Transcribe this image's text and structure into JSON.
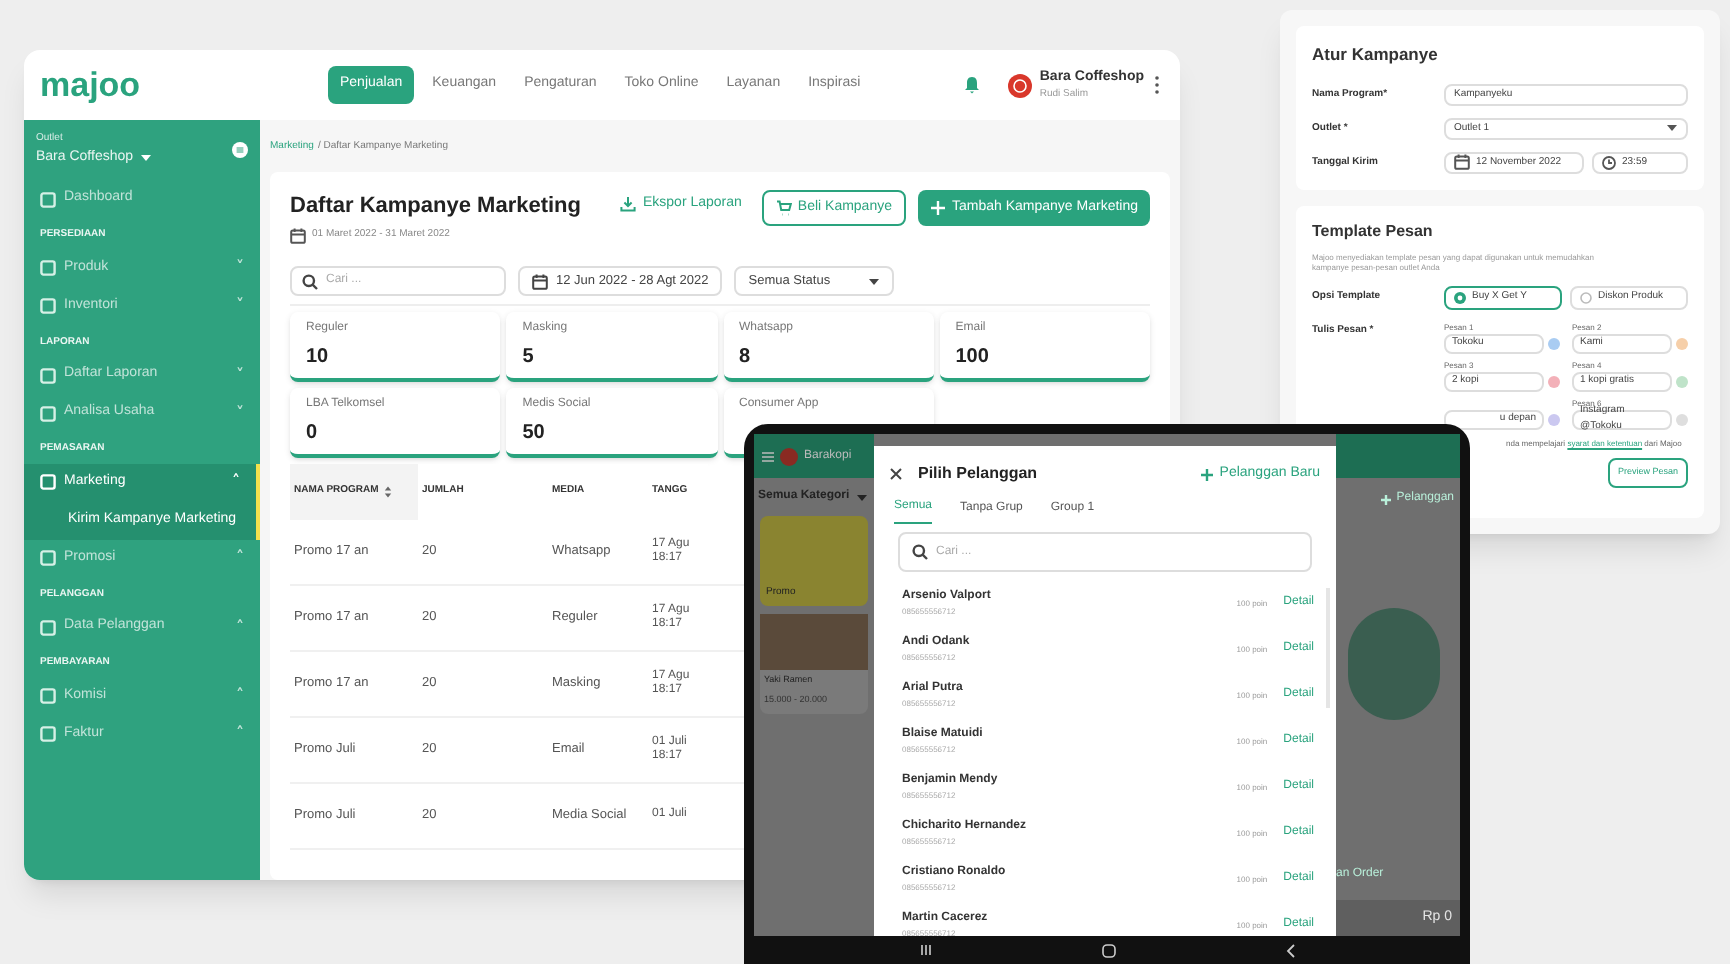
{
  "dashboard": {
    "logo": "majoo",
    "nav": [
      {
        "label": "Penjualan",
        "selected": true
      },
      {
        "label": "Keuangan",
        "selected": false
      },
      {
        "label": "Pengaturan",
        "selected": false
      },
      {
        "label": "Toko Online",
        "selected": false
      },
      {
        "label": "Layanan",
        "selected": false
      },
      {
        "label": "Inspirasi",
        "selected": false
      }
    ],
    "account": {
      "name": "Bara Coffeshop",
      "user": "Rudi Salim"
    },
    "sidebar": {
      "outlet_label": "Outlet",
      "outlet": "Bara Coffeshop",
      "sections": [
        {
          "items": [
            {
              "label": "Dashboard",
              "selected": false
            }
          ]
        },
        {
          "title": "PERSEDIAAN",
          "items": [
            {
              "label": "Produk",
              "toggle": "˅",
              "selected": false
            },
            {
              "label": "Inventori",
              "toggle": "˅",
              "selected": false
            }
          ]
        },
        {
          "title": "LAPORAN",
          "items": [
            {
              "label": "Daftar Laporan",
              "toggle": "˅",
              "selected": false
            },
            {
              "label": "Analisa Usaha",
              "toggle": "˅",
              "selected": false
            }
          ]
        },
        {
          "title": "PEMASARAN",
          "items": [
            {
              "label": "Marketing",
              "toggle": "˄",
              "selected": true,
              "children": [
                {
                  "label": "Kirim Kampanye Marketing",
                  "selected": true
                }
              ]
            },
            {
              "label": "Promosi",
              "toggle": "˄",
              "selected": false
            }
          ]
        },
        {
          "title": "PELANGGAN",
          "items": [
            {
              "label": "Data Pelanggan",
              "toggle": "˄",
              "selected": false
            }
          ]
        },
        {
          "title": "PEMBAYARAN",
          "items": [
            {
              "label": "Komisi",
              "toggle": "˄",
              "selected": false
            },
            {
              "label": "Faktur",
              "toggle": "˄",
              "selected": false
            }
          ]
        }
      ]
    },
    "breadcrumb": {
      "link": "Marketing",
      "current": "/ Daftar Kampanye Marketing"
    },
    "page": {
      "title": "Daftar Kampanye Marketing",
      "period": "01 Maret 2022 - 31 Maret 2022",
      "export": "Ekspor Laporan",
      "buy": "Beli Kampanye",
      "add": "Tambah Kampanye Marketing"
    },
    "filters": {
      "search_placeholder": "Cari ...",
      "date_range": "12 Jun 2022 - 28 Agt 2022",
      "status": "Semua Status"
    },
    "stats": [
      {
        "label": "Reguler",
        "value": "10"
      },
      {
        "label": "Masking",
        "value": "5"
      },
      {
        "label": "Whatsapp",
        "value": "8"
      },
      {
        "label": "Email",
        "value": "100"
      },
      {
        "label": "LBA Telkomsel",
        "value": "0"
      },
      {
        "label": "Medis Social",
        "value": "50"
      },
      {
        "label": "Consumer App"
      }
    ],
    "table": {
      "columns": [
        {
          "label": "NAMA PROGRAM",
          "sortable": true
        },
        {
          "label": "JUMLAH",
          "sortable": false
        },
        {
          "label": "MEDIA",
          "sortable": false
        },
        {
          "label": "TANGG",
          "sortable": false
        }
      ],
      "rows": [
        [
          "Promo 17 an",
          "20",
          "Whatsapp",
          "17 Agu",
          "18:17"
        ],
        [
          "Promo 17 an",
          "20",
          "Reguler",
          "17 Agu",
          "18:17"
        ],
        [
          "Promo 17 an",
          "20",
          "Masking",
          "17 Agu",
          "18:17"
        ],
        [
          "Promo Juli",
          "20",
          "Email",
          "01 Juli",
          "18:17"
        ],
        [
          "Promo Juli",
          "20",
          "Media Social",
          "01 Juli"
        ]
      ]
    }
  },
  "campaign_form": {
    "title": "Atur Kampanye",
    "fields": [
      {
        "label": "Nama Program*",
        "kind": "text",
        "value": "Kampanyeku"
      },
      {
        "label": "Outlet *",
        "kind": "select",
        "value": "Outlet 1"
      },
      {
        "label": "Tanggal Kirim",
        "kind": "datetime",
        "date": "12 November 2022",
        "time": "23:59"
      }
    ],
    "template": {
      "title": "Template Pesan",
      "description": "Majoo menyediakan template pesan yang dapat digunakan untuk memudahkan kampanye pesan-pesan outlet Anda",
      "option_label": "Opsi Template",
      "options": [
        {
          "label": "Buy X Get Y",
          "selected": true
        },
        {
          "label": "Diskon Produk",
          "selected": false
        }
      ],
      "message_label": "Tulis Pesan *",
      "messages": [
        {
          "label": "Pesan 1",
          "value": "Tokoku",
          "color": "#a9ccf2"
        },
        {
          "label": "Pesan 2",
          "value": "Kami",
          "color": "#f6cfa9"
        },
        {
          "label": "Pesan 3",
          "value": "2 kopi",
          "color": "#f3b0b8"
        },
        {
          "label": "Pesan 4",
          "value": "1 kopi gratis",
          "color": "#bfe3c9"
        },
        {
          "value": "u depan",
          "color": "#cbc8f0"
        },
        {
          "label": "Pesan 6",
          "value": "Instagram @Tokoku",
          "color": "#dedede"
        }
      ],
      "note": {
        "text": "nda mempelajari",
        "link": "syarat dan ketentuan",
        "after": "dari Majoo"
      },
      "preview": "Preview Pesan"
    }
  },
  "tablet": {
    "pos": {
      "store": "Barakopi",
      "category": "Semua Kategori",
      "promo": "Promo",
      "product": "Yaki Ramen",
      "price": "15.000 - 20.000",
      "add_customer": "Pelanggan",
      "order": "an Order",
      "total": "Rp 0"
    },
    "drawer": {
      "title": "Pilih Pelanggan",
      "new_button": "Pelanggan Baru",
      "tabs": [
        {
          "label": "Semua",
          "selected": true
        },
        {
          "label": "Tanpa Grup",
          "selected": false
        },
        {
          "label": "Group 1",
          "selected": false
        }
      ],
      "search_placeholder": "Cari ...",
      "customers": [
        {
          "name": "Arsenio Valport",
          "phone": "085655556712",
          "points": "100 poin",
          "action": "Detail"
        },
        {
          "name": "Andi Odank",
          "phone": "085655556712",
          "points": "100 poin",
          "action": "Detail"
        },
        {
          "name": "Arial Putra",
          "phone": "085655556712",
          "points": "100 poin",
          "action": "Detail"
        },
        {
          "name": "Blaise Matuidi",
          "phone": "085655556712",
          "points": "100 poin",
          "action": "Detail"
        },
        {
          "name": "Benjamin Mendy",
          "phone": "085655556712",
          "points": "100 poin",
          "action": "Detail"
        },
        {
          "name": "Chicharito Hernandez",
          "phone": "085655556712",
          "points": "100 poin",
          "action": "Detail"
        },
        {
          "name": "Cristiano Ronaldo",
          "phone": "085655556712",
          "points": "100 poin",
          "action": "Detail"
        },
        {
          "name": "Martin Cacerez",
          "phone": "085655556712",
          "points": "100 poin",
          "action": "Detail"
        }
      ]
    }
  }
}
